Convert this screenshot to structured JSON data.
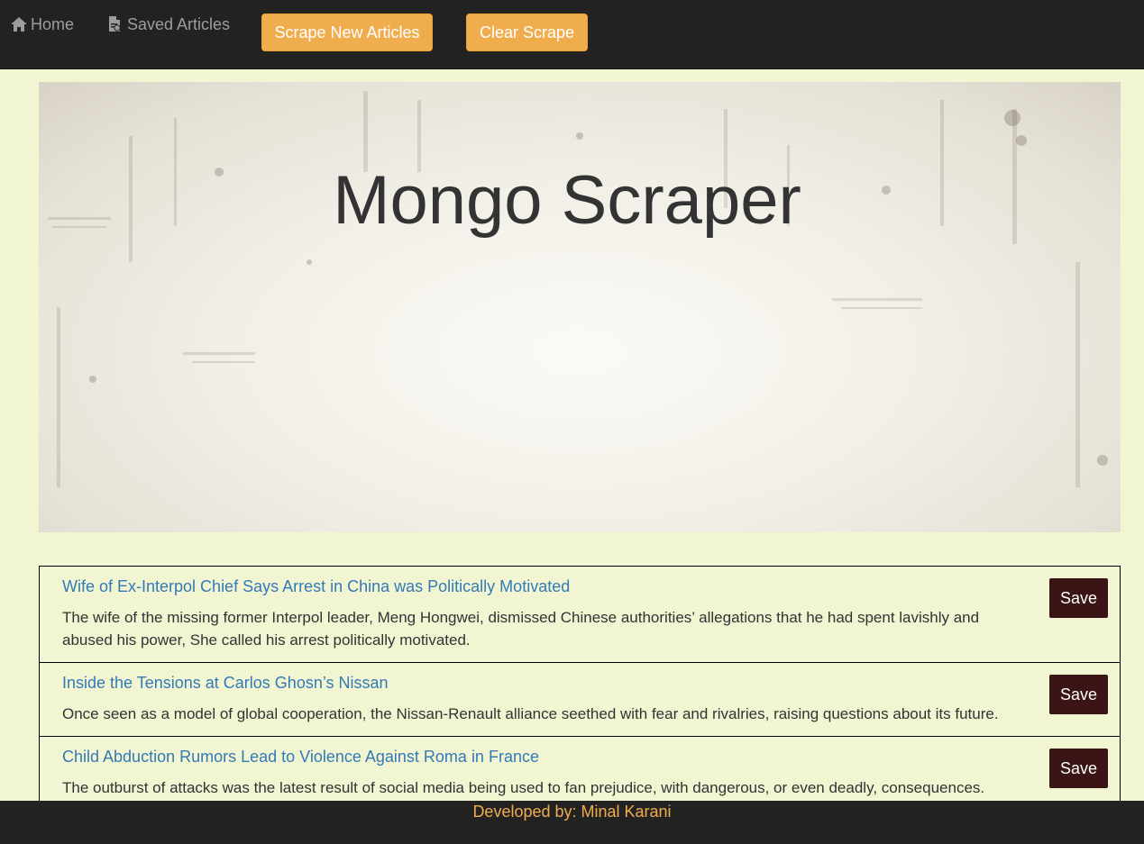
{
  "nav": {
    "home_label": "Home",
    "home_icon": "home-icon",
    "saved_label": "Saved Articles",
    "saved_icon": "document-icon",
    "scrape_button": "Scrape New Articles",
    "clear_button": "Clear Scrape"
  },
  "jumbotron": {
    "title": "Mongo Scraper"
  },
  "articles": [
    {
      "title": "Wife of Ex-Interpol Chief Says Arrest in China was Politically Motivated",
      "summary": "The wife of the missing former Interpol leader, Meng Hongwei, dismissed Chinese authorities’ allegations that he had spent lavishly and abused his power, She called his arrest politically motivated.",
      "save_label": "Save"
    },
    {
      "title": "Inside the Tensions at Carlos Ghosn’s Nissan",
      "summary": "Once seen as a model of global cooperation, the Nissan-Renault alliance seethed with fear and rivalries, raising questions about its future.",
      "save_label": "Save"
    },
    {
      "title": "Child Abduction Rumors Lead to Violence Against Roma in France",
      "summary": "The outburst of attacks was the latest result of social media being used to fan prejudice, with dangerous, or even deadly, consequences.",
      "save_label": "Save"
    }
  ],
  "footer": {
    "text": "Developed by: Minal Karani"
  },
  "colors": {
    "navbar": "#222222",
    "page_background": "#f1f5d2",
    "accent_orange": "#f0ad4e",
    "save_button": "#3b1515",
    "link_blue": "#337ab7"
  }
}
